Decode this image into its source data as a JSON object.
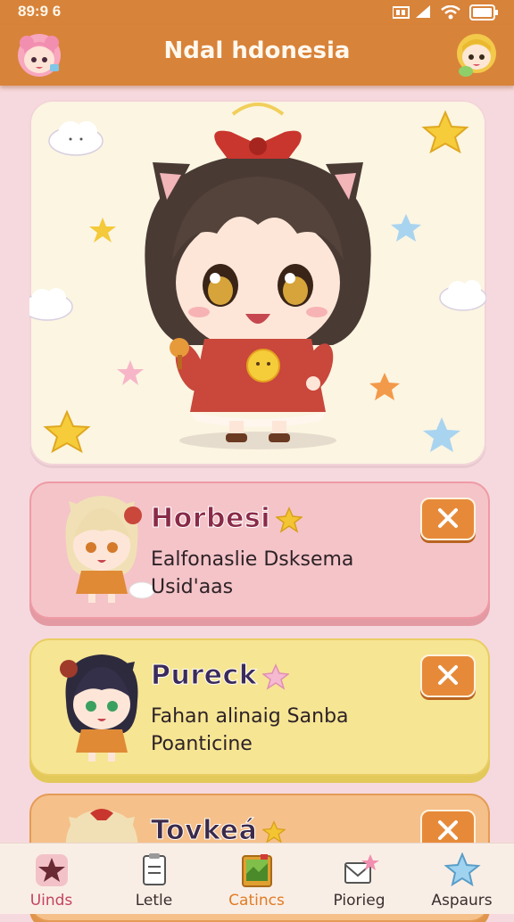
{
  "status_bar": {
    "time": "89:9 6"
  },
  "header": {
    "title": "Ndal hdonesia",
    "left_avatar_icon": "pink-hair-girl-avatar",
    "right_avatar_icon": "blonde-girl-avatar"
  },
  "hero": {
    "image_icon": "chibi-cat-girl-illustration"
  },
  "cards": [
    {
      "title": "Horbesi",
      "line1": "Ealfonaslie Dsksema",
      "line2": "Usid'aas",
      "star_color": "#f3c532"
    },
    {
      "title": "Pureck",
      "line1": "Fahan alinaig Sanba",
      "line2": "Poanticine",
      "star_color": "#f5b9d2"
    },
    {
      "title": "Tovkeá",
      "line1": "",
      "line2": "",
      "star_color": "#f3c532"
    }
  ],
  "tabs": [
    {
      "label": "Uinds",
      "icon": "star-badge-icon"
    },
    {
      "label": "Letle",
      "icon": "clipboard-icon"
    },
    {
      "label": "Catincs",
      "icon": "map-book-icon"
    },
    {
      "label": "Piorieg",
      "icon": "envelope-star-icon"
    },
    {
      "label": "Aspaurs",
      "icon": "blue-star-icon"
    }
  ],
  "colors": {
    "header": "#d8833a",
    "background": "#f6d9de",
    "accent": "#e07c24"
  }
}
